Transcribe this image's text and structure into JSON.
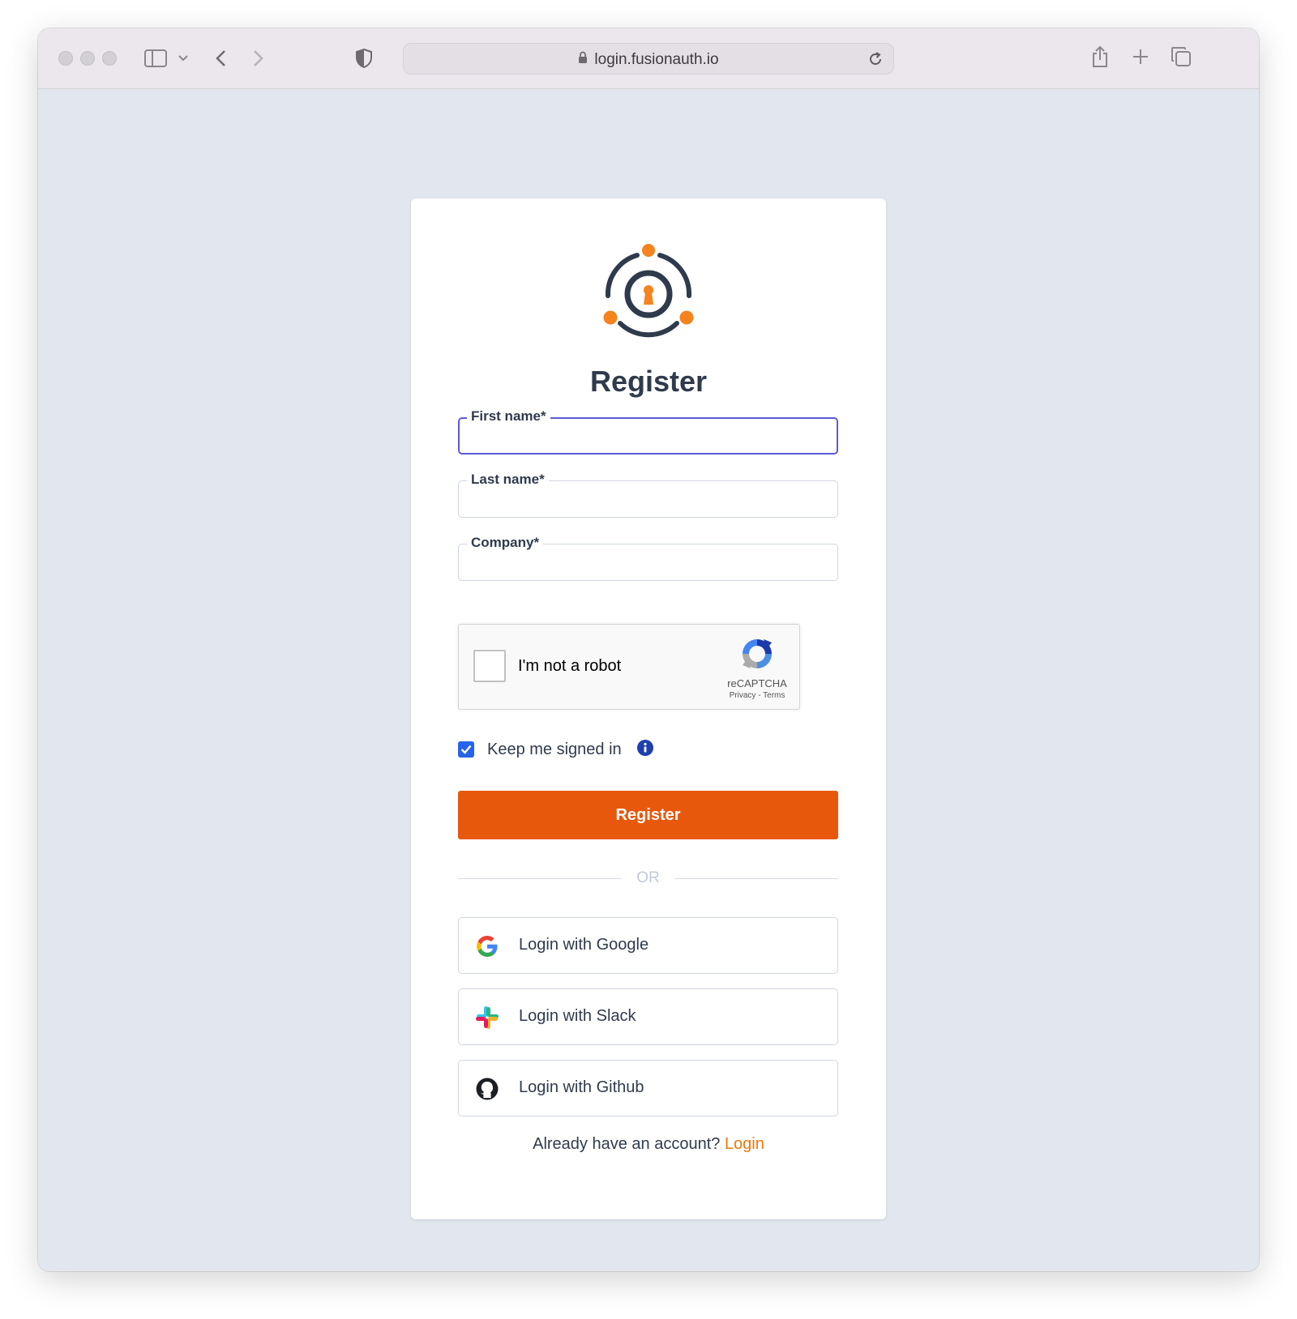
{
  "browser": {
    "url": "login.fusionauth.io"
  },
  "form": {
    "title": "Register",
    "fields": [
      {
        "label": "First name*",
        "value": ""
      },
      {
        "label": "Last name*",
        "value": ""
      },
      {
        "label": "Company*",
        "value": ""
      }
    ],
    "captcha": {
      "label": "I'm not a robot",
      "brand": "reCAPTCHA",
      "privacy": "Privacy",
      "separator": " - ",
      "terms": "Terms",
      "checked": false
    },
    "keep_signed_in": {
      "label": "Keep me signed in",
      "checked": true
    },
    "submit_label": "Register",
    "divider_label": "OR",
    "social": [
      {
        "label": "Login with Google",
        "icon": "google-icon"
      },
      {
        "label": "Login with Slack",
        "icon": "slack-icon"
      },
      {
        "label": "Login with Github",
        "icon": "github-icon"
      }
    ],
    "footer": {
      "prompt": "Already have an account? ",
      "link_label": "Login"
    }
  },
  "colors": {
    "page_bg": "#e2e7ef",
    "accent_orange": "#e8580c",
    "link_orange": "#e8790c",
    "text_dark": "#2f3b4c",
    "focus_purple": "#5b5bd6",
    "checkbox_blue": "#2563eb"
  }
}
